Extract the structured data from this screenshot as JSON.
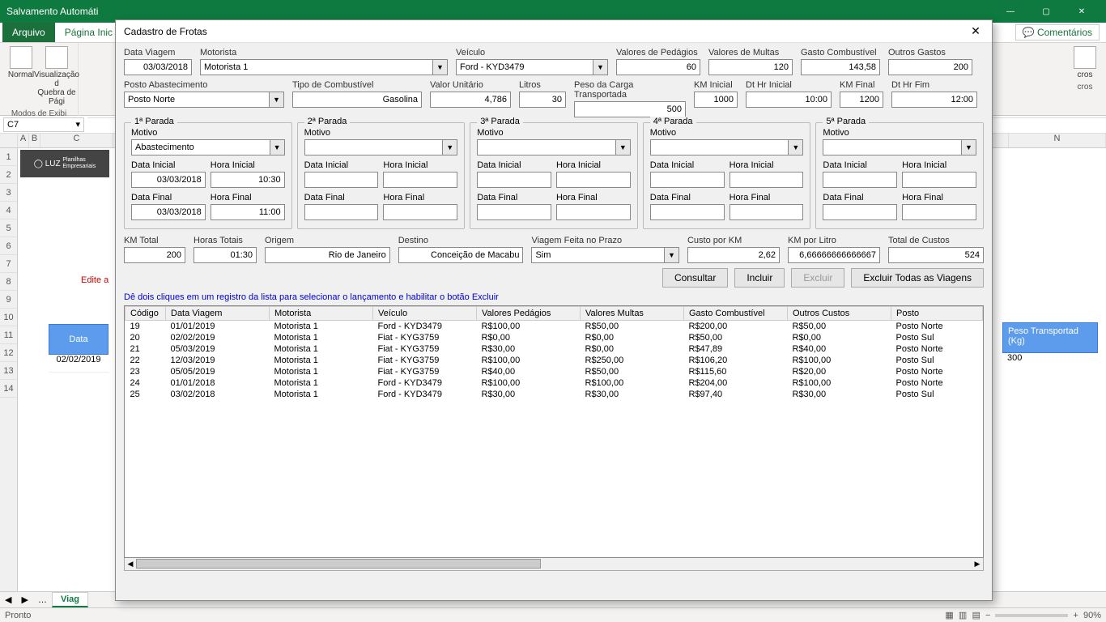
{
  "titlebar": {
    "autosave": "Salvamento Automáti"
  },
  "window_buttons": {
    "min": "—",
    "max": "▢",
    "close": "✕"
  },
  "excel_tabs": {
    "file": "Arquivo",
    "home": "Página Inic",
    "comments": "💬 Comentários"
  },
  "ribbon": {
    "normal": "Normal",
    "page_break": "Visualização d\nQuebra de Pági",
    "group1": "Modos de Exibi",
    "macros_tail": "cros",
    "group_tail": "cros"
  },
  "namebox": "C7",
  "bg": {
    "luz": "◯ LUZ",
    "luz_sub": "Planilhas\nEmpresariais",
    "edit": "Edite a",
    "data_col": "Data",
    "date_val": "02/02/2019",
    "peso_col": "Peso Transportad\n(Kg)",
    "peso_val": "300",
    "bigN": "N",
    "rownums": [
      1,
      2,
      3,
      4,
      5,
      6,
      7,
      8,
      9,
      10,
      11,
      12,
      13,
      14
    ],
    "cols": [
      "A",
      "B",
      "C"
    ]
  },
  "sheettabs": {
    "active": "Viag"
  },
  "status": {
    "pronto": "Pronto",
    "zoom_plus": "+",
    "zoom_minus": "−",
    "zoom": "90%"
  },
  "dialog": {
    "title": "Cadastro de Frotas",
    "row1": {
      "data_viagem": {
        "label": "Data Viagem",
        "value": "03/03/2018"
      },
      "motorista": {
        "label": "Motorista",
        "value": "Motorista 1"
      },
      "veiculo": {
        "label": "Veículo",
        "value": "Ford - KYD3479"
      },
      "pedagios": {
        "label": "Valores de Pedágios",
        "value": "60"
      },
      "multas": {
        "label": "Valores de Multas",
        "value": "120"
      },
      "combustivel": {
        "label": "Gasto Combustível",
        "value": "143,58"
      },
      "outros": {
        "label": "Outros Gastos",
        "value": "200"
      }
    },
    "row2": {
      "posto": {
        "label": "Posto Abastecimento",
        "value": "Posto Norte"
      },
      "tipo": {
        "label": "Tipo de Combustível",
        "value": "Gasolina"
      },
      "unit": {
        "label": "Valor Unitário",
        "value": "4,786"
      },
      "litros": {
        "label": "Litros",
        "value": "30"
      },
      "peso": {
        "label": "Peso da Carga Transportada",
        "value": "500"
      },
      "kmini": {
        "label": "KM Inicial",
        "value": "1000"
      },
      "dthrini": {
        "label": "Dt Hr Inicial",
        "value": "10:00"
      },
      "kmfinal": {
        "label": "KM Final",
        "value": "1200"
      },
      "dthrfim": {
        "label": "Dt Hr Fim",
        "value": "12:00"
      }
    },
    "paradas": {
      "labels": {
        "motivo": "Motivo",
        "data_inicial": "Data Inicial",
        "hora_inicial": "Hora Inicial",
        "data_final": "Data Final",
        "hora_final": "Hora Final"
      },
      "p1": {
        "legend": "1ª Parada",
        "motivo": "Abastecimento",
        "data_inicial": "03/03/2018",
        "hora_inicial": "10:30",
        "data_final": "03/03/2018",
        "hora_final": "11:00"
      },
      "p2": {
        "legend": "2ª Parada"
      },
      "p3": {
        "legend": "3ª Parada"
      },
      "p4": {
        "legend": "4ª Parada"
      },
      "p5": {
        "legend": "5ª Parada"
      }
    },
    "row3": {
      "kmtotal": {
        "label": "KM Total",
        "value": "200"
      },
      "horas": {
        "label": "Horas Totais",
        "value": "01:30"
      },
      "origem": {
        "label": "Origem",
        "value": "Rio de Janeiro"
      },
      "destino": {
        "label": "Destino",
        "value": "Conceição de Macabu"
      },
      "prazo": {
        "label": "Viagem Feita no Prazo",
        "value": "Sim"
      },
      "custokm": {
        "label": "Custo por KM",
        "value": "2,62"
      },
      "kmlitro": {
        "label": "KM por Litro",
        "value": "6,66666666666667"
      },
      "total": {
        "label": "Total de Custos",
        "value": "524"
      }
    },
    "buttons": {
      "consultar": "Consultar",
      "incluir": "Incluir",
      "excluir": "Excluir",
      "excluir_todas": "Excluir Todas as Viagens"
    },
    "hint": "Dê dois cliques em um registro da lista para selecionar o lançamento e habilitar o botão Excluir",
    "columns": [
      "Código",
      "Data Viagem",
      "Motorista",
      "Veículo",
      "Valores Pedágios",
      "Valores Multas",
      "Gasto Combustível",
      "Outros Custos",
      "Posto"
    ],
    "rows": [
      {
        "codigo": "19",
        "data": "01/01/2019",
        "motorista": "Motorista 1",
        "veiculo": "Ford - KYD3479",
        "ped": "R$100,00",
        "mul": "R$50,00",
        "comb": "R$200,00",
        "out": "R$50,00",
        "posto": "Posto Norte"
      },
      {
        "codigo": "20",
        "data": "02/02/2019",
        "motorista": "Motorista 1",
        "veiculo": "Fiat - KYG3759",
        "ped": "R$0,00",
        "mul": "R$0,00",
        "comb": "R$50,00",
        "out": "R$0,00",
        "posto": "Posto Sul"
      },
      {
        "codigo": "21",
        "data": "05/03/2019",
        "motorista": "Motorista 1",
        "veiculo": "Fiat - KYG3759",
        "ped": "R$30,00",
        "mul": "R$0,00",
        "comb": "R$47,89",
        "out": "R$40,00",
        "posto": "Posto Norte"
      },
      {
        "codigo": "22",
        "data": "12/03/2019",
        "motorista": "Motorista 1",
        "veiculo": "Fiat - KYG3759",
        "ped": "R$100,00",
        "mul": "R$250,00",
        "comb": "R$106,20",
        "out": "R$100,00",
        "posto": "Posto Sul"
      },
      {
        "codigo": "23",
        "data": "05/05/2019",
        "motorista": "Motorista 1",
        "veiculo": "Fiat - KYG3759",
        "ped": "R$40,00",
        "mul": "R$50,00",
        "comb": "R$115,60",
        "out": "R$20,00",
        "posto": "Posto Norte"
      },
      {
        "codigo": "24",
        "data": "01/01/2018",
        "motorista": "Motorista 1",
        "veiculo": "Ford - KYD3479",
        "ped": "R$100,00",
        "mul": "R$100,00",
        "comb": "R$204,00",
        "out": "R$100,00",
        "posto": "Posto Norte"
      },
      {
        "codigo": "25",
        "data": "03/02/2018",
        "motorista": "Motorista 1",
        "veiculo": "Ford - KYD3479",
        "ped": "R$30,00",
        "mul": "R$30,00",
        "comb": "R$97,40",
        "out": "R$30,00",
        "posto": "Posto Sul"
      }
    ]
  }
}
